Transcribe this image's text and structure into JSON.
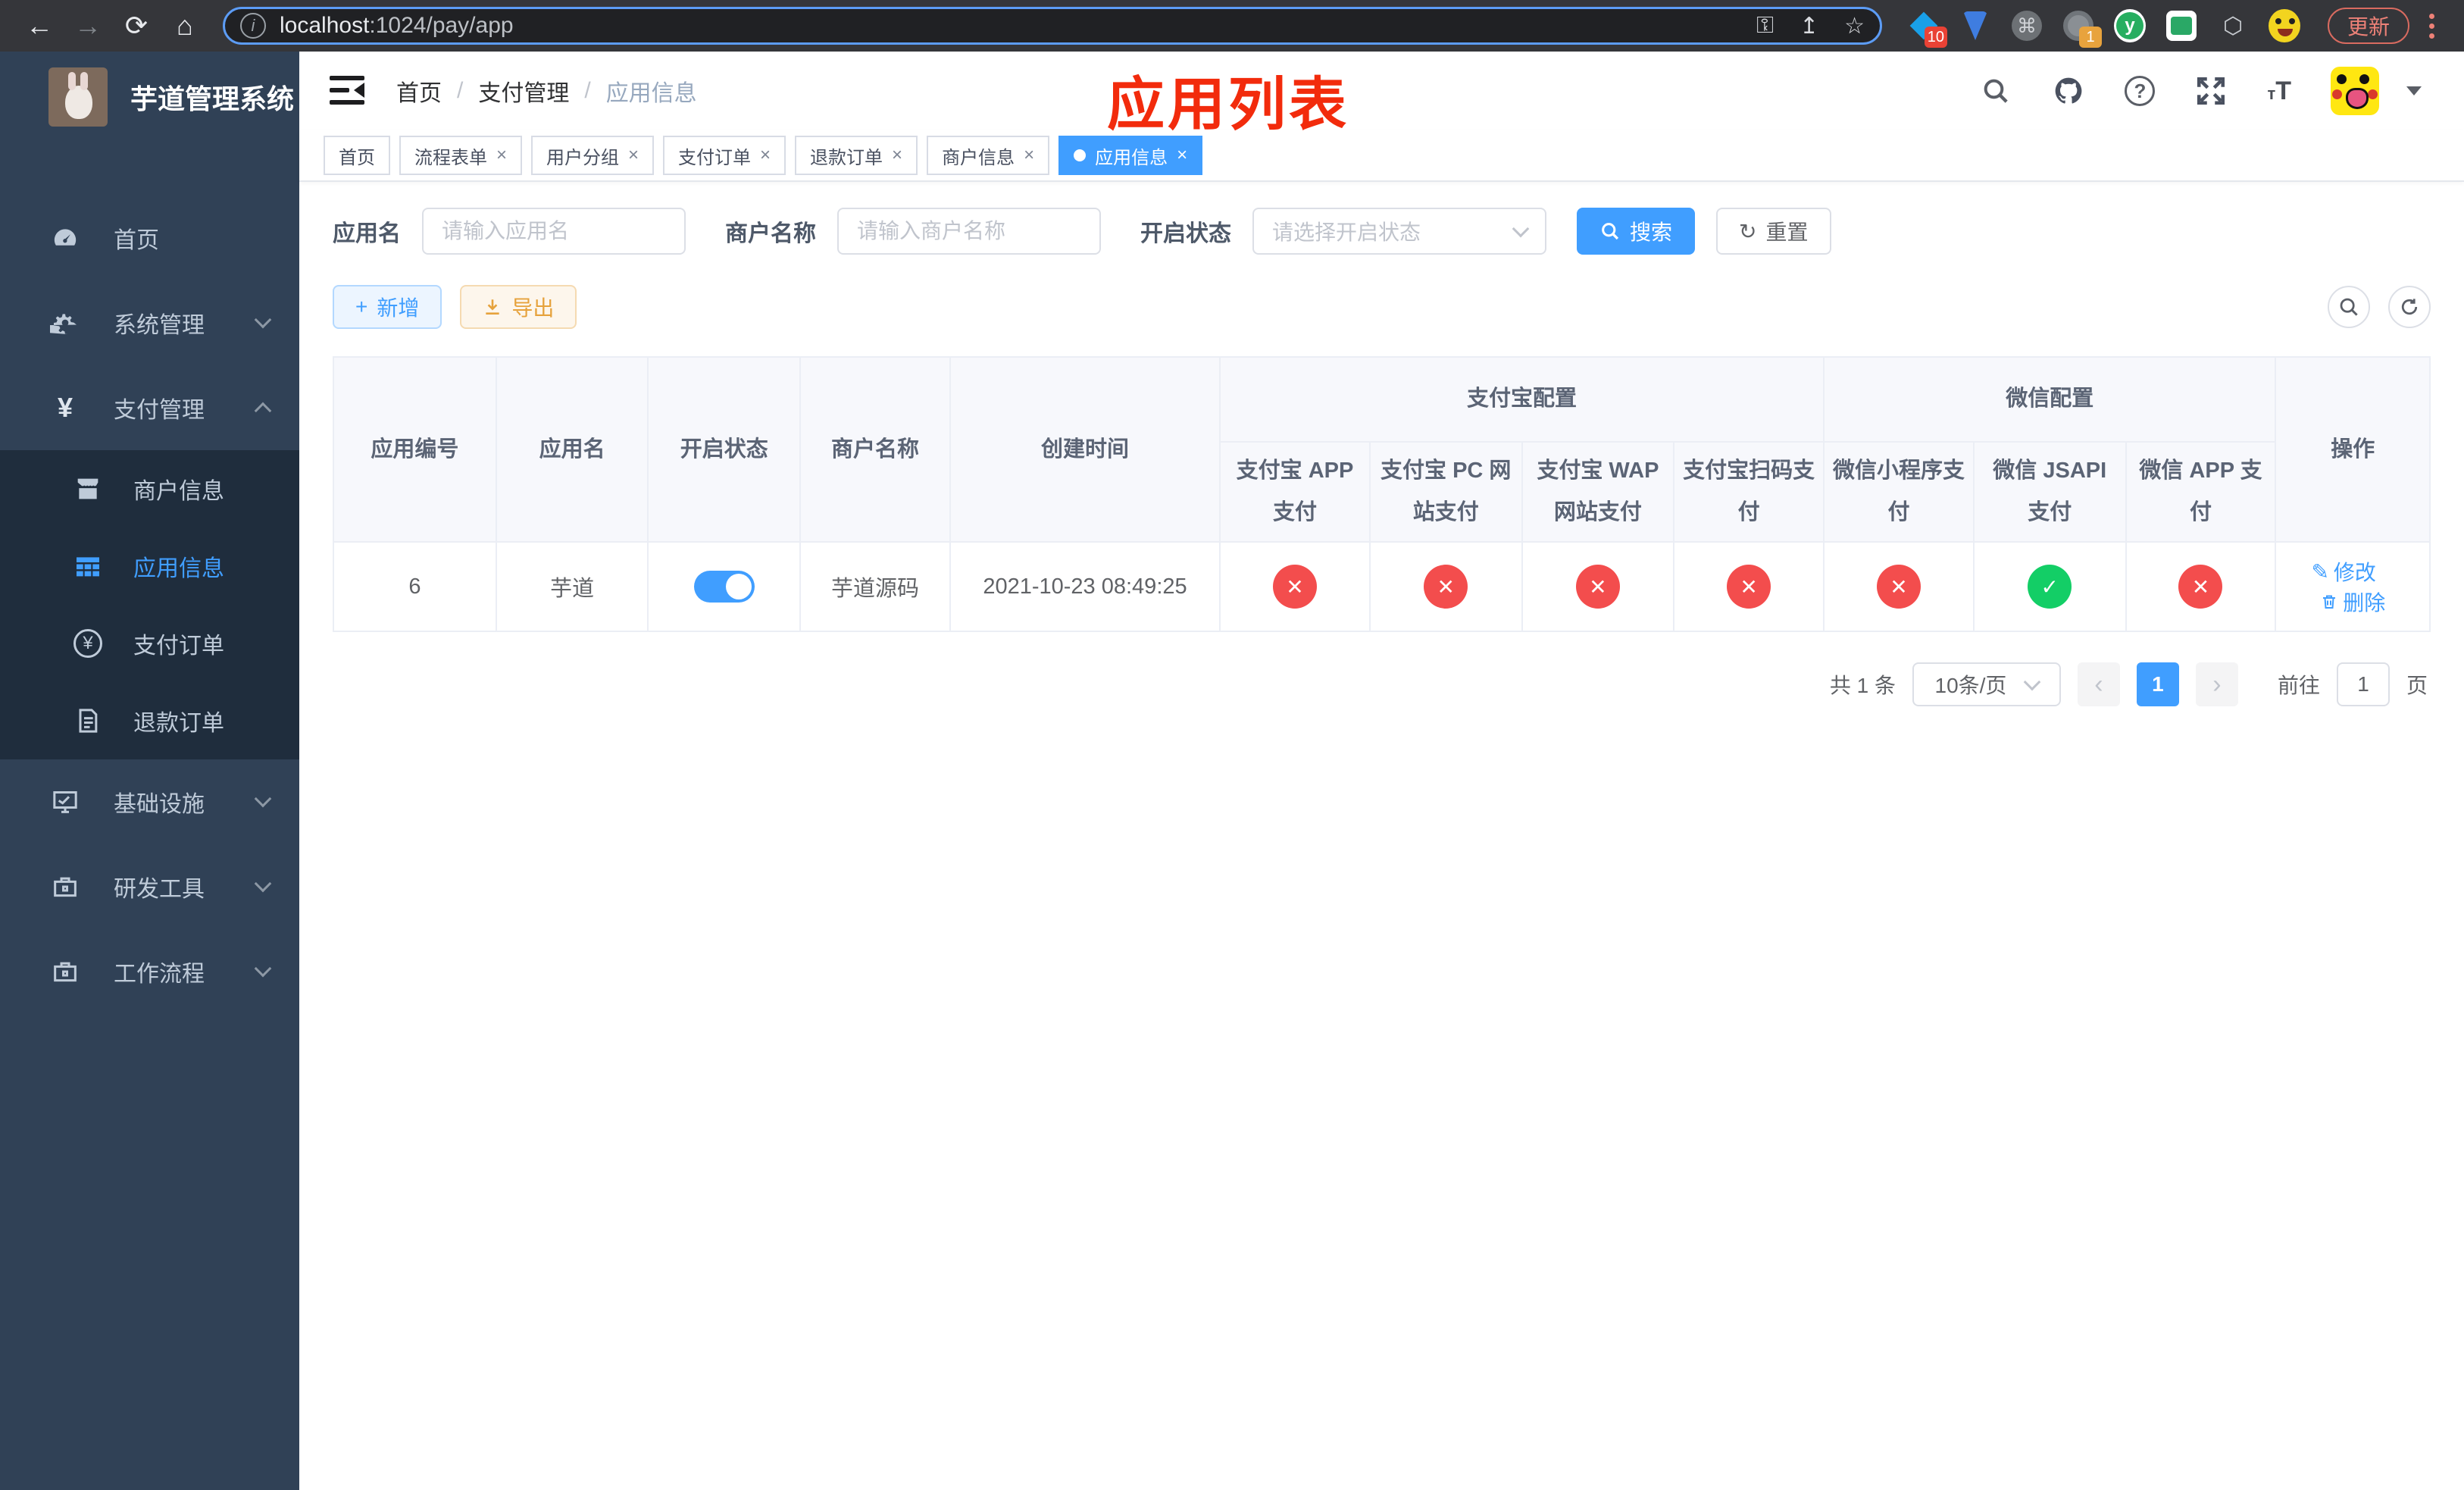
{
  "browser": {
    "url_host": "localhost",
    "url_path": ":1024/pay/app",
    "update_label": "更新",
    "ext_badge_blue": "10",
    "ext_badge_gray": "1",
    "y_letter": "y",
    "cmd_glyph": "⌘"
  },
  "sidebar": {
    "title": "芋道管理系统",
    "items": [
      {
        "label": "首页"
      },
      {
        "label": "系统管理"
      },
      {
        "label": "支付管理"
      },
      {
        "label": "商户信息"
      },
      {
        "label": "应用信息"
      },
      {
        "label": "支付订单"
      },
      {
        "label": "退款订单"
      },
      {
        "label": "基础设施"
      },
      {
        "label": "研发工具"
      },
      {
        "label": "工作流程"
      }
    ],
    "yen_glyph": "¥"
  },
  "header": {
    "breadcrumb": [
      "首页",
      "支付管理",
      "应用信息"
    ],
    "separator": "/",
    "caption": "应用列表",
    "help_glyph": "?"
  },
  "tabs": {
    "close_glyph": "×",
    "items": [
      {
        "label": "首页"
      },
      {
        "label": "流程表单"
      },
      {
        "label": "用户分组"
      },
      {
        "label": "支付订单"
      },
      {
        "label": "退款订单"
      },
      {
        "label": "商户信息"
      },
      {
        "label": "应用信息"
      }
    ]
  },
  "filters": {
    "app_name_label": "应用名",
    "app_name_placeholder": "请输入应用名",
    "merchant_label": "商户名称",
    "merchant_placeholder": "请输入商户名称",
    "status_label": "开启状态",
    "status_placeholder": "请选择开启状态",
    "search_label": "搜索",
    "reset_label": "重置",
    "reset_glyph": "↻"
  },
  "toolbar": {
    "add_label": "新增",
    "add_glyph": "+",
    "export_label": "导出"
  },
  "table": {
    "columns": [
      "应用编号",
      "应用名",
      "开启状态",
      "商户名称",
      "创建时间"
    ],
    "group_alipay": "支付宝配置",
    "group_wechat": "微信配置",
    "alipay_cols": [
      "支付宝 APP 支付",
      "支付宝 PC 网站支付",
      "支付宝 WAP 网站支付",
      "支付宝扫码支付"
    ],
    "wechat_cols": [
      "微信小程序支付",
      "微信 JSAPI 支付",
      "微信 APP 支付"
    ],
    "op_col": "操作",
    "row": {
      "id": "6",
      "name": "芋道",
      "merchant": "芋道源码",
      "created": "2021-10-23 08:49:25",
      "status_glyphs": [
        "✕",
        "✕",
        "✕",
        "✕",
        "✕",
        "✓",
        "✕"
      ],
      "edit_label": "修改",
      "edit_glyph": "✎",
      "delete_label": "删除"
    }
  },
  "pagination": {
    "total": "共 1 条",
    "page_size": "10条/页",
    "prev_glyph": "‹",
    "next_glyph": "›",
    "page": "1",
    "goto_label": "前往",
    "goto_value": "1",
    "page_suffix": "页"
  }
}
